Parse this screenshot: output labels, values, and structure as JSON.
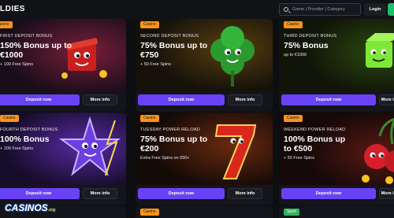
{
  "header": {
    "brand_label": "LDIES",
    "search_placeholder": "Game | Provider | Category",
    "login_label": "Login"
  },
  "cards": [
    {
      "tag": "Casino",
      "kicker": "FIRST DEPOSIT BONUS",
      "headline": "150% Bonus up to €1000",
      "sub": "+ 100 Free Spins",
      "deposit_label": "Deposit now",
      "more_label": "More info"
    },
    {
      "tag": "Casino",
      "kicker": "SECOND DEPOSIT BONUS",
      "headline": "75% Bonus up to €750",
      "sub": "+ 50 Free Spins",
      "deposit_label": "Deposit now",
      "more_label": "More info"
    },
    {
      "tag": "Casino",
      "kicker": "THIRD DEPOSIT BONUS",
      "headline": "75% Bonus",
      "sub": "up to €1000",
      "deposit_label": "Deposit now",
      "more_label": "More info"
    },
    {
      "tag": "Casino",
      "kicker": "FOURTH DEPOSIT BONUS",
      "headline": "100% Bonus",
      "sub": "+ 100 Free Spins",
      "deposit_label": "Deposit now",
      "more_label": "More info"
    },
    {
      "tag": "Casino",
      "kicker": "TUESDAY POWER RELOAD",
      "headline": "75% Bonus up to €200",
      "sub": "Extra Free Spins on €50+",
      "deposit_label": "Deposit now",
      "more_label": "More info"
    },
    {
      "tag": "Casino",
      "kicker": "WEEKEND POWER RELOAD",
      "headline": "100% Bonus up to €500",
      "sub": "+ 50 Free Spins",
      "deposit_label": "Deposit now",
      "more_label": "More info"
    }
  ],
  "bottom_tags": [
    "Casino",
    "Sport"
  ],
  "logo": {
    "text": "CASINOS",
    "suffix": ".org"
  },
  "colors": {
    "accent": "#6a42f5",
    "tag": "#f7931e",
    "sport_tag": "#2fb45a",
    "signup": "#19c36b"
  }
}
